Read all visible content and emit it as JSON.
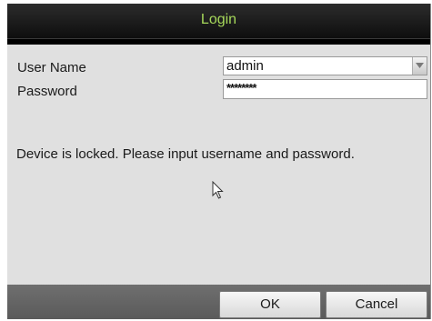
{
  "dialog": {
    "title": "Login"
  },
  "form": {
    "username_label": "User Name",
    "username_value": "admin",
    "password_label": "Password",
    "password_value": "********"
  },
  "message": "Device is locked. Please input username and password.",
  "buttons": {
    "ok_label": "OK",
    "cancel_label": "Cancel"
  },
  "icons": {
    "dropdown": "chevron-down-icon",
    "pointer": "mouse-cursor-icon"
  },
  "colors": {
    "title_text": "#a6d85a",
    "titlebar_bg": "#1a1a1a",
    "content_bg": "#e0e0e0",
    "footer_bg": "#636363"
  }
}
